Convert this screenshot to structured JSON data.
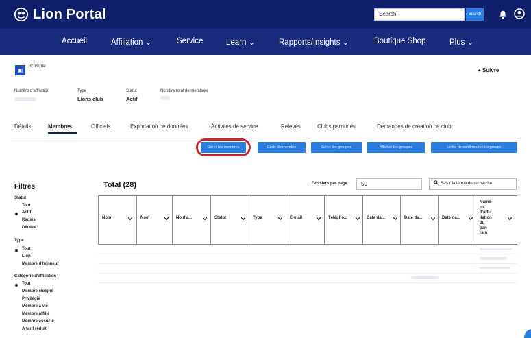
{
  "header": {
    "app_title": "Lion Portal",
    "search_placeholder": "Search",
    "search_button": "Search"
  },
  "nav": {
    "items": [
      "Accueil",
      "Affiliation ⌄",
      "Service",
      "Learn ⌄",
      "Rapports/Insights ⌄",
      "Boutique Shop",
      "Plus ⌄"
    ]
  },
  "account": {
    "type_label": "Compte",
    "follow_label": "+ Suivre",
    "fields": [
      {
        "label": "Numéro d'affiliation",
        "value": ""
      },
      {
        "label": "Type",
        "value": "Lions club"
      },
      {
        "label": "Statut",
        "value": "Actif"
      },
      {
        "label": "Nombre total de membres",
        "value": ""
      }
    ]
  },
  "tabs": [
    "Détails",
    "Membres",
    "Officiels",
    "Exportation de données",
    "Activités de service",
    "Relevés",
    "Clubs parrainés",
    "Demandes de création de club"
  ],
  "active_tab": "Membres",
  "actions": [
    "Gérer les membres",
    "Carte de membre",
    "Gérer les groupes",
    "Afficher les groupes",
    "Lettre de confirmation de groupe"
  ],
  "filters": {
    "title": "Filtres",
    "groups": [
      {
        "title": "Statut",
        "options": [
          "Tout",
          "Actif",
          "Radiés",
          "Décédé"
        ],
        "selected": "Actif"
      },
      {
        "title": "Type",
        "options": [
          "Tout",
          "Lion",
          "Membre d'honneur"
        ],
        "selected": "Tout"
      },
      {
        "title": "Catégorie d'affiliation",
        "options": [
          "Tout",
          "Membre éloigné",
          "Privilégié",
          "Membre à vie",
          "Membre affilié",
          "Membre associé",
          "À tarif réduit"
        ],
        "selected": "Tout"
      }
    ]
  },
  "table": {
    "total_label": "Total (28)",
    "per_page_label": "Dossiers par page",
    "per_page_value": "50",
    "search_placeholder": "Saisir la terme de recherche",
    "columns": [
      "Nom",
      "Nom",
      "No d'a...",
      "Statut",
      "Type",
      "E-mail",
      "Télépho...",
      "Date da...",
      "Date da...",
      "Date da...",
      "Numé-ro d'affi-liation du par-rain"
    ]
  },
  "colors": {
    "header_bg": "#0f1f6b",
    "nav_bg": "#182b7d",
    "accent": "#2a7de1",
    "highlight": "#c9252d"
  }
}
